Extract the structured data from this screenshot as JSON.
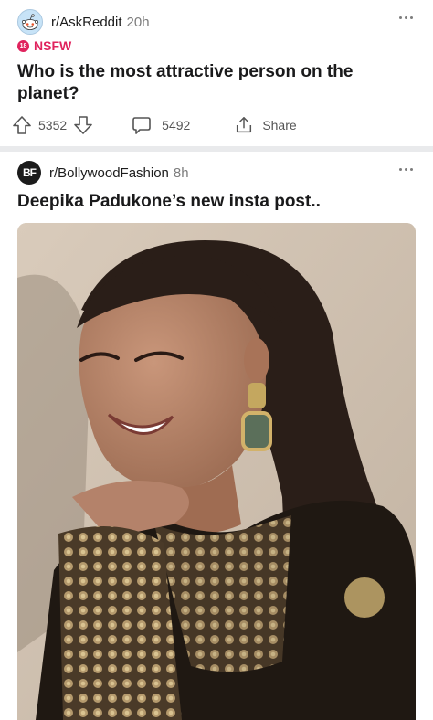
{
  "feed": {
    "posts": [
      {
        "subreddit": "r/AskReddit",
        "age": "20h",
        "flair": "NSFW",
        "flair_icon_text": "18",
        "title": "Who is the most attractive person on the planet?",
        "upvotes": "5352",
        "comments": "5492",
        "share_label": "Share",
        "avatar_icon": "reddit-snoo-icon"
      },
      {
        "subreddit": "r/BollywoodFashion",
        "age": "8h",
        "title": "Deepika Padukone’s new insta post..",
        "avatar_text": "BF",
        "image_subject": "photo-woman-smiling-black-gold-embroidered-outfit"
      }
    ]
  },
  "colors": {
    "nsfw": "#e0245e",
    "text_primary": "#1a1a1b",
    "text_secondary": "#7c7c7c",
    "feed_background": "#e9eaec"
  }
}
